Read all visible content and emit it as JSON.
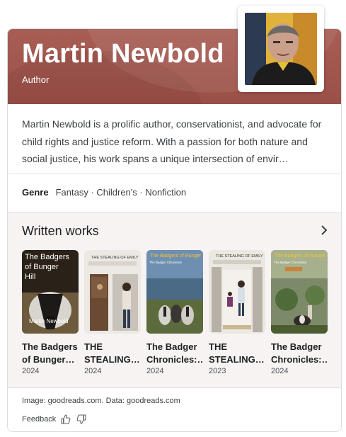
{
  "header": {
    "name": "Martin Newbold",
    "subtitle": "Author"
  },
  "description": "Martin Newbold is a prolific author, conservationist, and advocate for child rights and justice reform. With a passion for both nature and social justice, his work spans a unique intersection of envir…",
  "genre": {
    "label": "Genre",
    "value": "Fantasy · Children's · Nonfiction"
  },
  "written_works": {
    "heading": "Written works",
    "books": [
      {
        "title": "The Badgers of Bunger…",
        "year": "2024",
        "cover_text": "The Badgers of Bunger Hill",
        "cover_author": "Martin Newbold"
      },
      {
        "title": "THE STEALING…",
        "year": "2024",
        "cover_text": "THE STEALING OF EMILY"
      },
      {
        "title": "The Badger Chronicles:…",
        "year": "2024",
        "cover_text": "The Badgers of Bunger Hill"
      },
      {
        "title": "THE STEALING…",
        "year": "2023",
        "cover_text": "THE STEALING OF EMILY"
      },
      {
        "title": "The Badger Chronicles:…",
        "year": "2024",
        "cover_text": "The Badgers of Bunger Hill"
      }
    ]
  },
  "footer": {
    "attribution": "Image: goodreads.com. Data: goodreads.com",
    "feedback": "Feedback"
  },
  "colors": {
    "hero": "#a05a52",
    "works_bg": "#f6f3f2"
  }
}
